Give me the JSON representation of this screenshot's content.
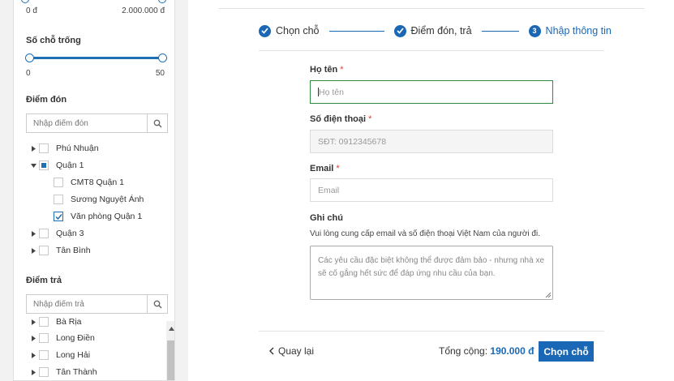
{
  "price": {
    "min": "0 đ",
    "max": "2.000.000 đ"
  },
  "seats": {
    "title": "Số chỗ trống",
    "min": "0",
    "max": "50"
  },
  "pickup": {
    "title": "Điểm đón",
    "placeholder": "Nhập điểm đón",
    "items": [
      {
        "label": "Phú Nhuận"
      },
      {
        "label": "Quận 1"
      },
      {
        "label": "CMT8 Quận 1"
      },
      {
        "label": "Sương Nguyệt Ánh"
      },
      {
        "label": "Văn phòng Quận 1"
      },
      {
        "label": "Quận 3"
      },
      {
        "label": "Tân Bình"
      }
    ]
  },
  "dropoff": {
    "title": "Điểm trả",
    "placeholder": "Nhập điểm trả",
    "items": [
      {
        "label": "Bà Rịa"
      },
      {
        "label": "Long Điền"
      },
      {
        "label": "Long Hải"
      },
      {
        "label": "Tân Thành"
      }
    ]
  },
  "steps": [
    {
      "label": "Chọn chỗ"
    },
    {
      "label": "Điểm đón, trả"
    },
    {
      "label": "Nhập thông tin",
      "number": "3"
    }
  ],
  "form": {
    "name": {
      "label": "Họ tên",
      "required": "*",
      "placeholder": "Họ tên"
    },
    "phone": {
      "label": "Số điện thoại",
      "required": "*",
      "placeholder": "SĐT: 0912345678"
    },
    "email": {
      "label": "Email",
      "required": "*",
      "placeholder": "Email"
    },
    "note": {
      "label": "Ghi chú",
      "hint": "Vui lòng cung cấp email và số điện thoại Việt Nam của người đi.",
      "placeholder": "Các yêu cầu đặc biệt không thể được đảm bảo - nhưng nhà xe sẽ cố gắng hết sức để đáp ứng nhu cầu của bạn."
    }
  },
  "footer": {
    "back": "Quay lại",
    "total_label": "Tổng cộng:",
    "total_value": "190.000 đ",
    "next": "Chọn chỗ"
  },
  "colors": {
    "accent": "#1a68b5",
    "focus": "#2f8a3f",
    "required": "#e53935"
  }
}
